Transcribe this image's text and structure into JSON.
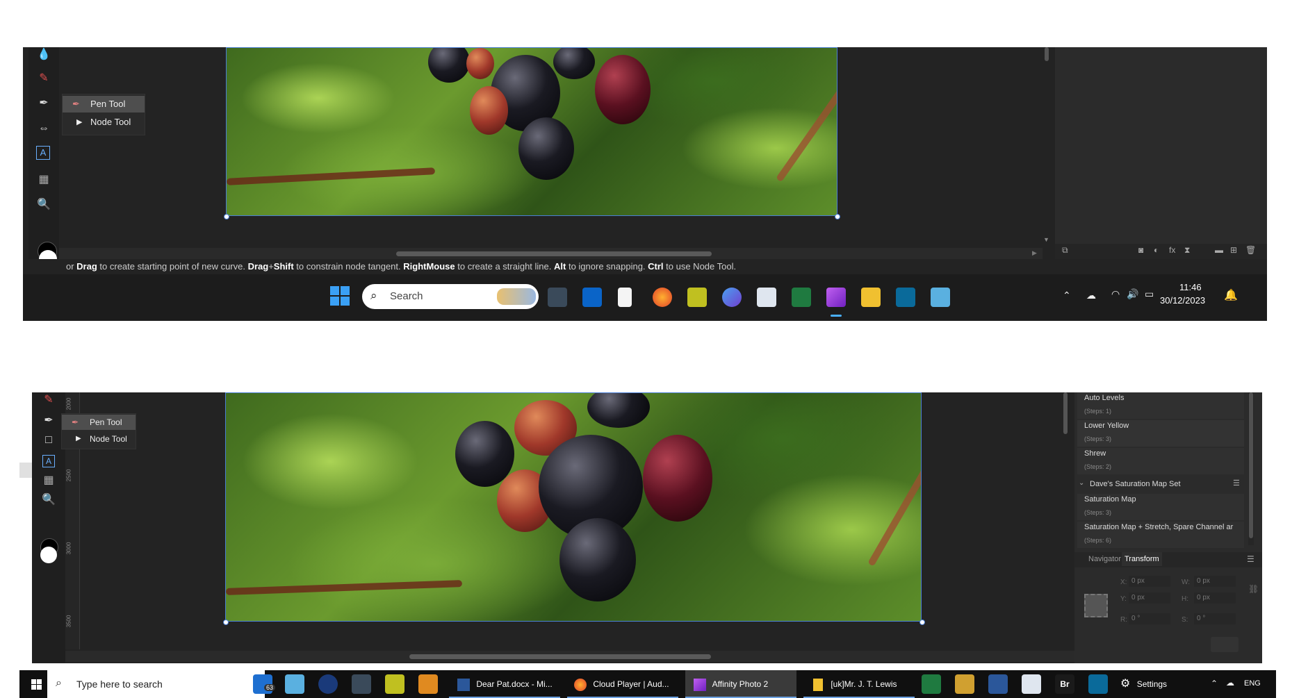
{
  "top": {
    "tool_flyout": {
      "pen": "Pen Tool",
      "node": "Node Tool"
    },
    "status_hint": [
      {
        "t": "or ",
        "b": false
      },
      {
        "t": "Drag",
        "b": true
      },
      {
        "t": " to create starting point of new curve. ",
        "b": false
      },
      {
        "t": "Drag",
        "b": true
      },
      {
        "t": "+",
        "b": false
      },
      {
        "t": "Shift",
        "b": true
      },
      {
        "t": " to constrain node tangent. ",
        "b": false
      },
      {
        "t": "RightMouse",
        "b": true
      },
      {
        "t": " to create a straight line. ",
        "b": false
      },
      {
        "t": "Alt",
        "b": true
      },
      {
        "t": " to ignore snapping. ",
        "b": false
      },
      {
        "t": "Ctrl",
        "b": true
      },
      {
        "t": " to use Node Tool.",
        "b": false
      }
    ],
    "taskbar": {
      "search_placeholder": "Search",
      "clock_time": "11:46",
      "clock_date": "30/12/2023"
    }
  },
  "bottom": {
    "tool_flyout": {
      "pen": "Pen Tool",
      "node": "Node Tool"
    },
    "ruler_labels": [
      "2000",
      "2500",
      "3000",
      "3500"
    ],
    "history": [
      {
        "name": "Auto Levels",
        "steps": "(Steps: 1)"
      },
      {
        "name": "Lower Yellow",
        "steps": "(Steps: 3)"
      },
      {
        "name": "Shrew",
        "steps": "(Steps: 2)"
      }
    ],
    "macro_group": "Dave's Saturation Map Set",
    "macro_items": [
      {
        "name": "Saturation Map",
        "steps": "(Steps: 3)"
      },
      {
        "name": "Saturation Map + Stretch, Spare Channel ar",
        "steps": "(Steps: 6)"
      }
    ],
    "tabs": {
      "navigator": "Navigator",
      "transform": "Transform"
    },
    "transform": {
      "x_label": "X:",
      "x_value": "0 px",
      "y_label": "Y:",
      "y_value": "0 px",
      "w_label": "W:",
      "w_value": "0 px",
      "h_label": "H:",
      "h_value": "0 px",
      "r_label": "R:",
      "r_value": "0 °",
      "s_label": "S:",
      "s_value": "0 °"
    },
    "taskbar": {
      "search_placeholder": "Type here to search",
      "mail_badge": "63",
      "tasks": [
        "Dear Pat.docx - Mi...",
        "Cloud Player | Aud...",
        "Affinity Photo 2",
        "[uk]Mr. J. T. Lewis"
      ],
      "settings": "Settings",
      "lang": "ENG",
      "br_label": "Br"
    }
  },
  "colors": {
    "app_bg": "#232323",
    "panel_bg": "#2b2b2b",
    "accent": "#4a7fd6",
    "taskbar11": "#1c1c1c",
    "taskbar10": "#101010"
  }
}
